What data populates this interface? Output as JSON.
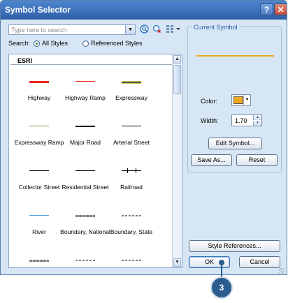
{
  "window": {
    "title": "Symbol Selector",
    "help_label": "?",
    "close_label": "✕"
  },
  "search": {
    "placeholder": "Type here to search",
    "label": "Search:",
    "options": [
      "All Styles",
      "Referenced Styles"
    ],
    "selected": "All Styles"
  },
  "toolbar_icons": [
    "dropdown-arrow-icon",
    "search-icon",
    "clear-search-icon",
    "view-options-icon"
  ],
  "list": {
    "group": "ESRI",
    "items": [
      {
        "name": "Highway",
        "color": "#e8271f",
        "style": "thick"
      },
      {
        "name": "Highway Ramp",
        "color": "#e8271f",
        "style": "thin"
      },
      {
        "name": "Expressway",
        "color": "#555555",
        "style": "cased"
      },
      {
        "name": "Expressway Ramp",
        "color": "#8a8f3a",
        "style": "thin"
      },
      {
        "name": "Major Road",
        "color": "#000000",
        "style": "medium"
      },
      {
        "name": "Arterial Street",
        "color": "#000000",
        "style": "thin"
      },
      {
        "name": "Collector Street",
        "color": "#000000",
        "style": "thin"
      },
      {
        "name": "Residential Street",
        "color": "#000000",
        "style": "thin"
      },
      {
        "name": "Railroad",
        "color": "#000000",
        "style": "rail"
      },
      {
        "name": "River",
        "color": "#4aa3df",
        "style": "thin"
      },
      {
        "name": "Boundary, National",
        "color": "#7f7f7f",
        "style": "dashed-thick"
      },
      {
        "name": "Boundary, State",
        "color": "#7f7f7f",
        "style": "dashed"
      },
      {
        "name": "",
        "color": "#7f7f7f",
        "style": "dashed-thick"
      },
      {
        "name": "",
        "color": "#7f7f7f",
        "style": "dashed"
      },
      {
        "name": "",
        "color": "#7f7f7f",
        "style": "dashed"
      }
    ]
  },
  "current_symbol": {
    "label": "Current Symbol",
    "preview_color": "#f0a81a",
    "color_label": "Color:",
    "color_value": "#f0a81a",
    "width_label": "Width:",
    "width_value": "1.70"
  },
  "buttons": {
    "edit_symbol": "Edit Symbol...",
    "save_as": "Save As...",
    "reset": "Reset",
    "style_references": "Style References...",
    "ok": "OK",
    "cancel": "Cancel"
  },
  "callout": {
    "number": "3"
  }
}
